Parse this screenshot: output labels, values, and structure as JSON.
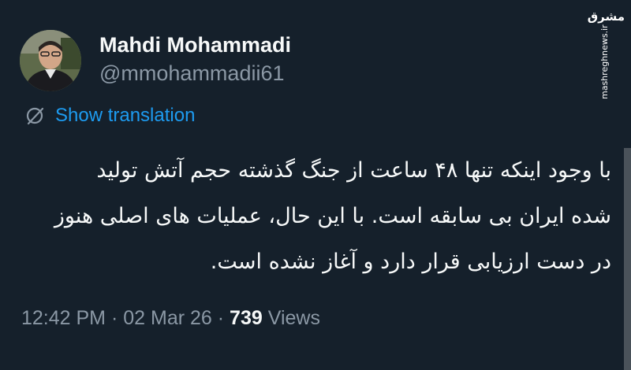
{
  "author": {
    "display_name": "Mahdi Mohammadi",
    "handle": "@mmohammadii61"
  },
  "translation": {
    "label": "Show translation",
    "icon": "translate-icon"
  },
  "tweet": {
    "lines": [
      "با وجود اینکه تنها ۴۸ ساعت از جنگ گذشته حجم آتش تولید",
      "شده ایران بی سابقه است. با این حال، عملیات های اصلی هنوز",
      "در دست ارزیابی قرار دارد و آغاز نشده است."
    ]
  },
  "meta": {
    "time": "12:42 PM",
    "separator": "·",
    "date": "02 Mar 26",
    "views_count": "739",
    "views_label": "Views"
  },
  "watermark": {
    "logo": "مشرق",
    "url": "mashreghnews.ir"
  },
  "colors": {
    "background": "#15202b",
    "text": "#f7f9f9",
    "secondary": "#8b98a5",
    "link": "#1d9bf0"
  }
}
